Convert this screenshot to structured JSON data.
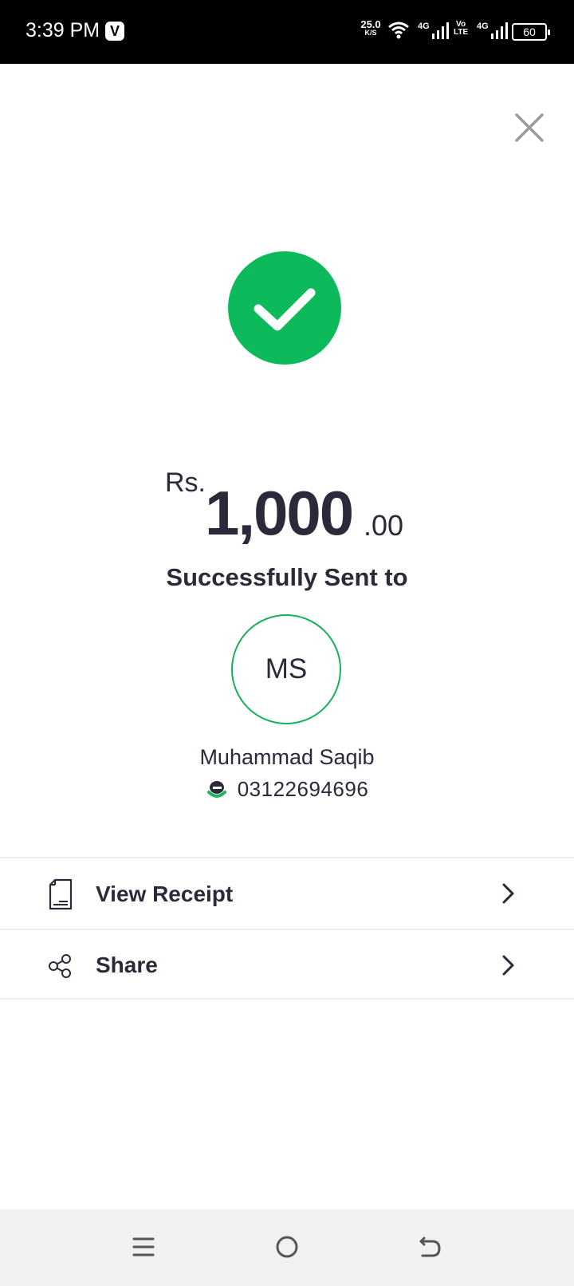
{
  "status_bar": {
    "time": "3:39 PM",
    "app_badge": "V",
    "net_speed_value": "25.0",
    "net_speed_unit": "K/S",
    "network_1": "4G",
    "volte_top": "Vo",
    "volte_bottom": "LTE",
    "network_2": "4G",
    "battery": "60"
  },
  "header": {
    "close_icon": "close-icon"
  },
  "result": {
    "status_icon": "check-icon",
    "currency": "Rs.",
    "amount_whole": "1,000",
    "amount_decimal": ".00",
    "message": "Successfully Sent to"
  },
  "recipient": {
    "initials": "MS",
    "name": "Muhammad Saqib",
    "wallet_icon": "easypaisa-wallet-icon",
    "phone": "03122694696"
  },
  "actions": [
    {
      "label": "View Receipt",
      "icon": "receipt-icon"
    },
    {
      "label": "Share",
      "icon": "share-icon"
    }
  ],
  "colors": {
    "accent_green": "#0cba5c",
    "text_dark": "#2b2a3a",
    "divider": "#efefef",
    "nav_bg": "#f1f1f1"
  }
}
